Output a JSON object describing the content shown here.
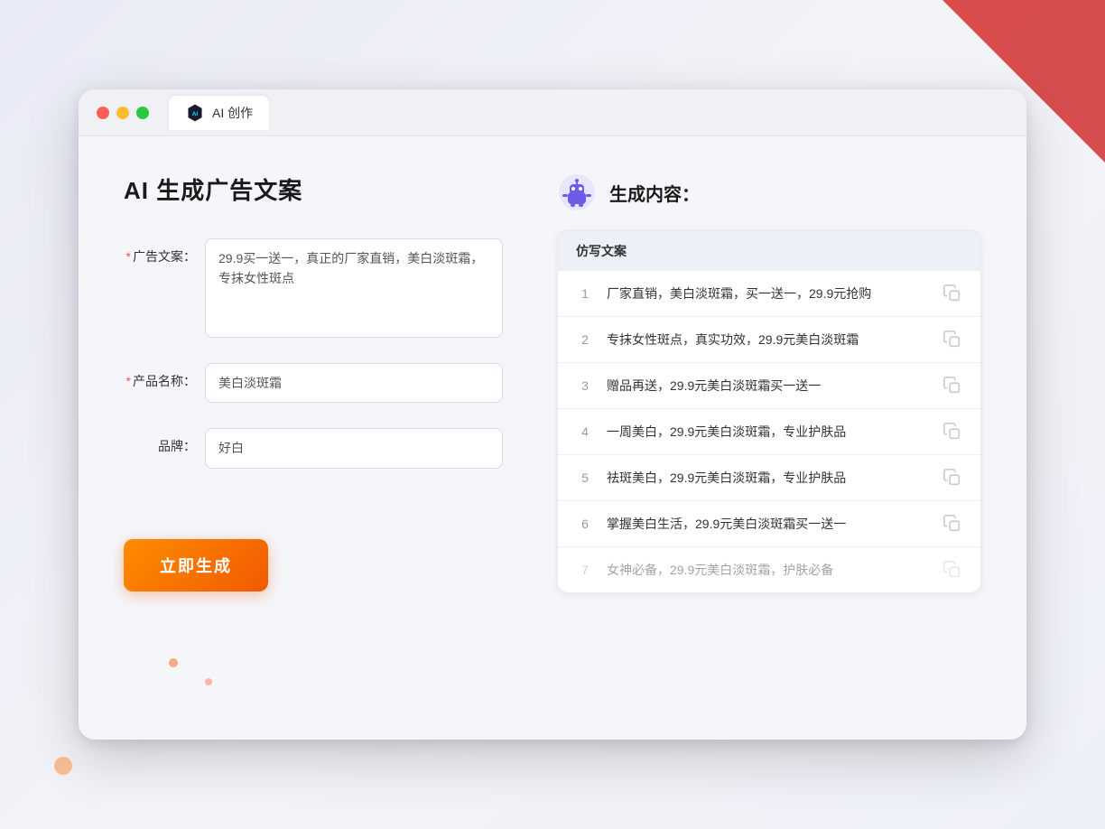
{
  "window": {
    "tab_label": "AI 创作"
  },
  "page": {
    "title": "AI 生成广告文案"
  },
  "form": {
    "ad_copy_label": "广告文案：",
    "ad_copy_required": "*",
    "ad_copy_value": "29.9买一送一，真正的厂家直销，美白淡斑霜，专抹女性斑点",
    "product_name_label": "产品名称：",
    "product_name_required": "*",
    "product_name_value": "美白淡斑霜",
    "brand_label": "品牌：",
    "brand_value": "好白",
    "generate_button": "立即生成"
  },
  "result": {
    "header_label": "生成内容：",
    "table_header": "仿写文案",
    "rows": [
      {
        "num": "1",
        "text": "厂家直销，美白淡斑霜，买一送一，29.9元抢购",
        "faded": false
      },
      {
        "num": "2",
        "text": "专抹女性斑点，真实功效，29.9元美白淡斑霜",
        "faded": false
      },
      {
        "num": "3",
        "text": "赠品再送，29.9元美白淡斑霜买一送一",
        "faded": false
      },
      {
        "num": "4",
        "text": "一周美白，29.9元美白淡斑霜，专业护肤品",
        "faded": false
      },
      {
        "num": "5",
        "text": "祛斑美白，29.9元美白淡斑霜，专业护肤品",
        "faded": false
      },
      {
        "num": "6",
        "text": "掌握美白生活，29.9元美白淡斑霜买一送一",
        "faded": false
      },
      {
        "num": "7",
        "text": "女神必备，29.9元美白淡斑霜，护肤必备",
        "faded": true
      }
    ]
  }
}
